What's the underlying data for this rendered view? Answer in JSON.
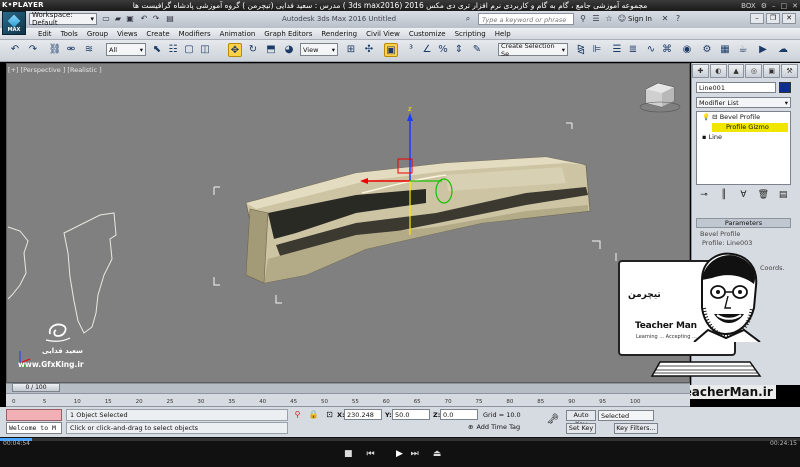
{
  "player": {
    "logo": "K•PLAYER",
    "title": "مجموعه آموزشی جامع ، گام به گام و کاربردی نرم افزار تری دی مکس 2016 (3ds max2016 )  مدرس : سعید فدایی (تیچرمن ) گروه آموزشی پادشاه گرافیست ها",
    "right_label": "BOX",
    "time_elapsed": "00:04:54",
    "time_total": "00:24:15"
  },
  "titlebar": {
    "app_logo": "MAX",
    "workspace": "Workspace: Default",
    "app_title": "Autodesk 3ds Max 2016    Untitled",
    "search_placeholder": "Type a keyword or phrase",
    "signin": "Sign In"
  },
  "menu": [
    "Edit",
    "Tools",
    "Group",
    "Views",
    "Create",
    "Modifiers",
    "Animation",
    "Graph Editors",
    "Rendering",
    "Civil View",
    "Customize",
    "Scripting",
    "Help"
  ],
  "toolbar": {
    "filter": "All",
    "ref_coord": "View",
    "selection_set": "Create Selection Se"
  },
  "viewport": {
    "label": "[+] [Perspective ] [Realistic ]"
  },
  "command_panel": {
    "tabs": [
      "✚",
      "◐",
      "▲",
      "◎",
      "▣",
      "⚒"
    ],
    "object_name": "Line001",
    "modifier_list": "Modifier List",
    "stack": [
      "Bevel Profile",
      "Profile Gizmo",
      "Line"
    ],
    "rollout": "Parameters",
    "bevel_label": "Bevel Profile",
    "profile_label": "Profile: Line003",
    "coords_label": "Coords."
  },
  "watermarks": {
    "author_fa": "سعید فدایی",
    "site": "www.GfxKing.ir",
    "teacher_logo": "تیچرمن",
    "teacher_name": "Teacher Man",
    "teacher_tag": "Learning ... Accepting ...",
    "teacher_url": "www.TeacherMan.ir"
  },
  "timeline": {
    "frame": "0 / 100",
    "ticks": [
      "0",
      "5",
      "10",
      "15",
      "20",
      "25",
      "30",
      "35",
      "40",
      "45",
      "50",
      "55",
      "60",
      "65",
      "70",
      "75",
      "80",
      "85",
      "90",
      "95",
      "100"
    ]
  },
  "status": {
    "maxscript": "Welcome to M",
    "selection": "1 Object Selected",
    "prompt": "Click or click-and-drag to select objects",
    "x": "230.248",
    "y": "50.0",
    "z": "0.0",
    "grid": "Grid = 10.0",
    "add_time_tag": "Add Time Tag",
    "auto_key": "Auto Key",
    "set_key": "Set Key",
    "key_selection": "Selected",
    "key_filters": "Key Filters..."
  }
}
